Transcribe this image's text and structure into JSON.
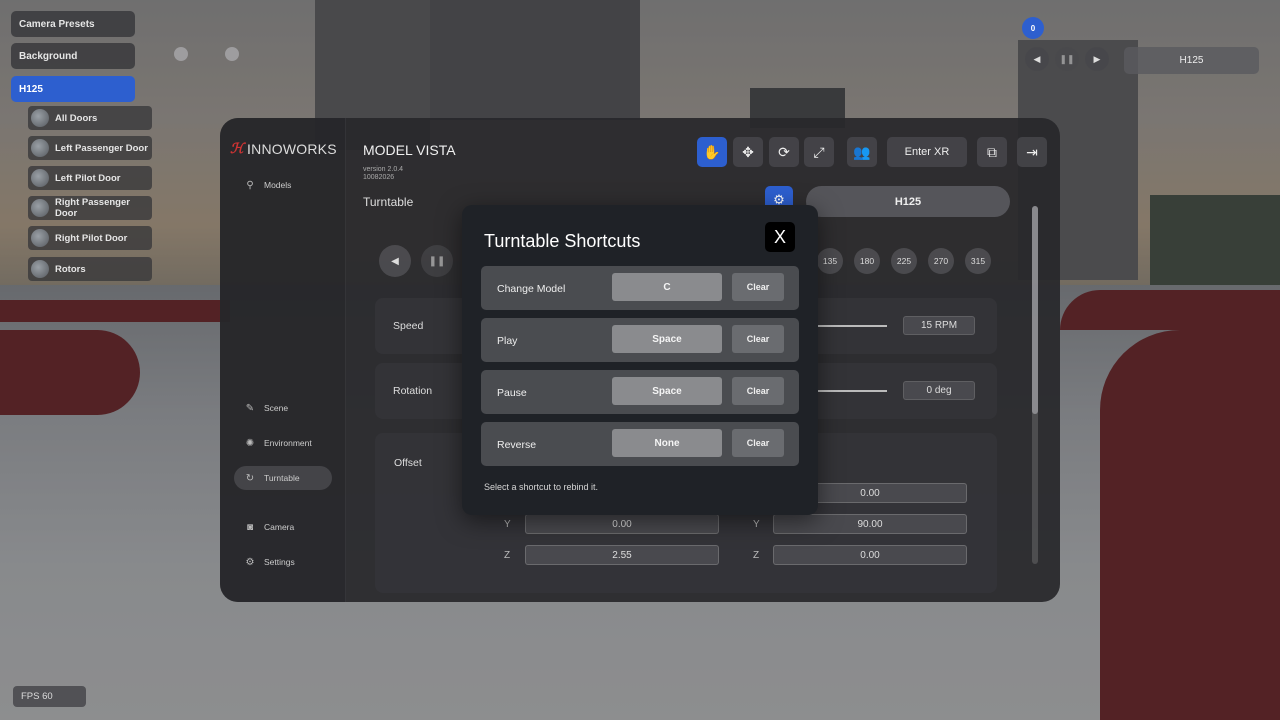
{
  "scene": {
    "camera_presets_label": "Camera Presets",
    "background_label": "Background",
    "model_label": "H125",
    "children": [
      {
        "label": "All Doors"
      },
      {
        "label": "Left Passenger Door"
      },
      {
        "label": "Left Pilot Door"
      },
      {
        "label": "Right Passenger Door"
      },
      {
        "label": "Right Pilot Door"
      },
      {
        "label": "Rotors"
      }
    ]
  },
  "timeline": {
    "active_index": "0",
    "current_model": "H125"
  },
  "app": {
    "brand": "INNOWORKS",
    "title": "MODEL VISTA",
    "version": "version 2.0.4",
    "build": "10082026"
  },
  "sidebar": {
    "items": [
      {
        "label": "Models",
        "icon": "models-icon"
      },
      {
        "label": "Scene",
        "icon": "scene-icon"
      },
      {
        "label": "Environment",
        "icon": "environment-icon"
      },
      {
        "label": "Turntable",
        "icon": "turntable-icon",
        "active": true
      },
      {
        "label": "Camera",
        "icon": "camera-icon"
      },
      {
        "label": "Settings",
        "icon": "gear-icon"
      }
    ]
  },
  "toolbar": {
    "enter_xr_label": "Enter XR"
  },
  "turntable": {
    "section_title": "Turntable",
    "model_name": "H125",
    "angles": [
      "135",
      "180",
      "225",
      "270",
      "315"
    ],
    "speed_label": "Speed",
    "speed_value": "15 RPM",
    "rotation_label": "Rotation",
    "rotation_value": "0 deg",
    "offset_label": "Offset",
    "offset_left": {
      "y": "0.00",
      "z": "2.55"
    },
    "offset_right": {
      "x": "0.00",
      "y": "90.00",
      "z": "0.00"
    },
    "axis_labels": {
      "y": "Y",
      "z": "Z"
    }
  },
  "modal": {
    "title": "Turntable Shortcuts",
    "close_label": "X",
    "rows": [
      {
        "label": "Change Model",
        "key": "C",
        "clear": "Clear"
      },
      {
        "label": "Play",
        "key": "Space",
        "clear": "Clear"
      },
      {
        "label": "Pause",
        "key": "Space",
        "clear": "Clear"
      },
      {
        "label": "Reverse",
        "key": "None",
        "clear": "Clear"
      }
    ],
    "hint": "Select a shortcut to rebind it."
  },
  "status": {
    "fps": "FPS 60"
  },
  "colors": {
    "accent": "#2d5fcf",
    "brand_mark": "#cc3333"
  }
}
